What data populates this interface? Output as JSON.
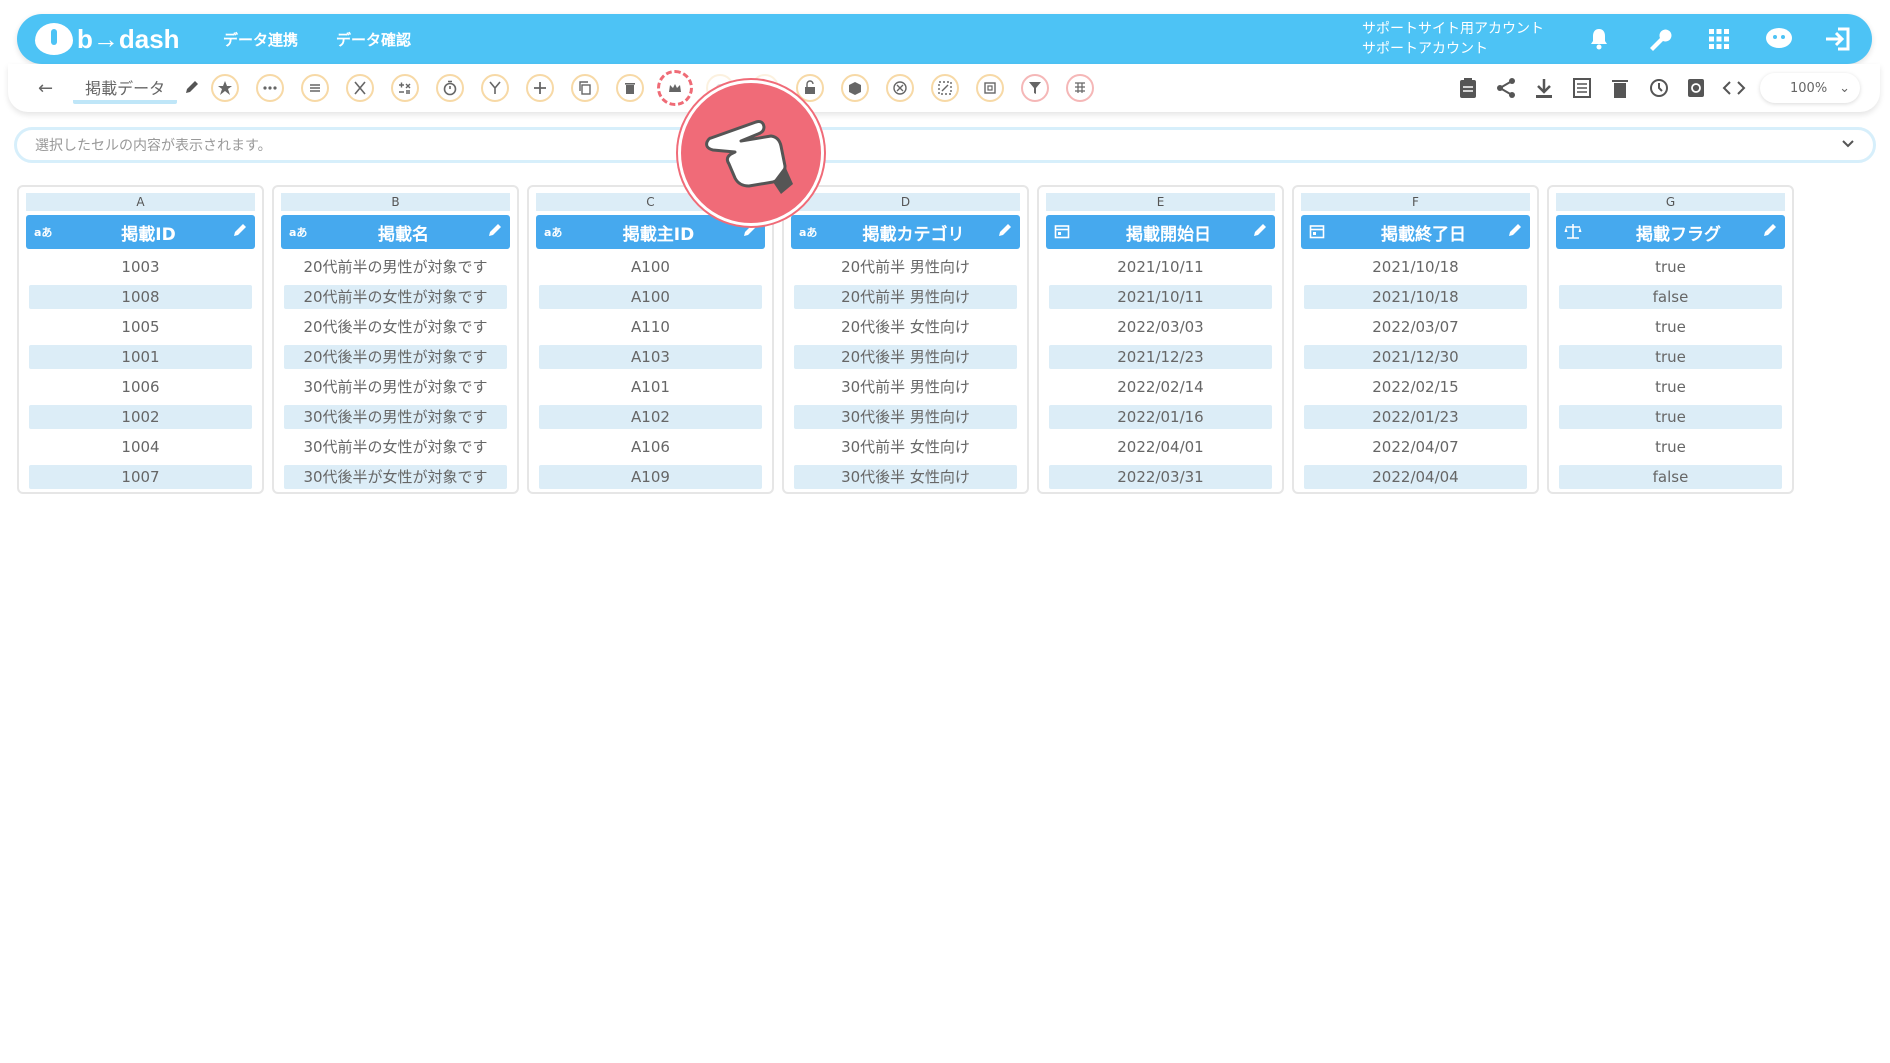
{
  "app": {
    "logo_text": "b→dash",
    "brand_color": "#4dc3f5"
  },
  "topnav": {
    "links": [
      "データ連携",
      "データ確認"
    ],
    "account_line1": "サポートサイト用アカウント",
    "account_line2": "サポートアカウント",
    "icons": [
      "bell-icon",
      "wrench-icon",
      "grid-menu-icon",
      "chat-bot-icon",
      "logout-icon"
    ]
  },
  "toolbar": {
    "title": "掲載データ",
    "tools": [
      "star-icon",
      "more-icon",
      "list-icon",
      "scissors-icon",
      "compute-icon",
      "timer-icon",
      "merge-icon",
      "plus-icon",
      "copy-icon",
      "trash-icon",
      "crown-icon",
      "hidden-icon-1",
      "hidden-icon-2",
      "lock-icon",
      "box-icon",
      "cancel-icon",
      "transform-icon",
      "frame-icon",
      "filter-icon",
      "pivot-icon"
    ],
    "right_icons": [
      "clipboard-icon",
      "share-icon",
      "download-icon",
      "sheet-icon",
      "delete-icon",
      "history-icon",
      "refresh-icon",
      "code-icon"
    ],
    "zoom": "100%"
  },
  "cellbar": {
    "placeholder": "選択したセルの内容が表示されます。"
  },
  "columns": [
    {
      "letter": "A",
      "type": "aあ",
      "name": "掲載ID",
      "cells": [
        "1003",
        "1008",
        "1005",
        "1001",
        "1006",
        "1002",
        "1004",
        "1007"
      ]
    },
    {
      "letter": "B",
      "type": "aあ",
      "name": "掲載名",
      "cells": [
        "20代前半の男性が対象です",
        "20代前半の女性が対象です",
        "20代後半の女性が対象です",
        "20代後半の男性が対象です",
        "30代前半の男性が対象です",
        "30代後半の男性が対象です",
        "30代前半の女性が対象です",
        "30代後半が女性が対象です"
      ]
    },
    {
      "letter": "C",
      "type": "aあ",
      "name": "掲載主ID",
      "cells": [
        "A100",
        "A100",
        "A110",
        "A103",
        "A101",
        "A102",
        "A106",
        "A109"
      ]
    },
    {
      "letter": "D",
      "type": "aあ",
      "name": "掲載カテゴリ",
      "cells": [
        "20代前半 男性向け",
        "20代前半 男性向け",
        "20代後半 女性向け",
        "20代後半 男性向け",
        "30代前半 男性向け",
        "30代後半 男性向け",
        "30代前半 女性向け",
        "30代後半 女性向け"
      ]
    },
    {
      "letter": "E",
      "type": "calendar-icon",
      "name": "掲載開始日",
      "cells": [
        "2021/10/11",
        "2021/10/11",
        "2022/03/03",
        "2021/12/23",
        "2022/02/14",
        "2022/01/16",
        "2022/04/01",
        "2022/03/31"
      ]
    },
    {
      "letter": "F",
      "type": "calendar-icon",
      "name": "掲載終了日",
      "cells": [
        "2021/10/18",
        "2021/10/18",
        "2022/03/07",
        "2021/12/30",
        "2022/02/15",
        "2022/01/23",
        "2022/04/07",
        "2022/04/04"
      ]
    },
    {
      "letter": "G",
      "type": "scale-icon",
      "name": "掲載フラグ",
      "cells": [
        "true",
        "false",
        "true",
        "true",
        "true",
        "true",
        "true",
        "false"
      ]
    }
  ]
}
